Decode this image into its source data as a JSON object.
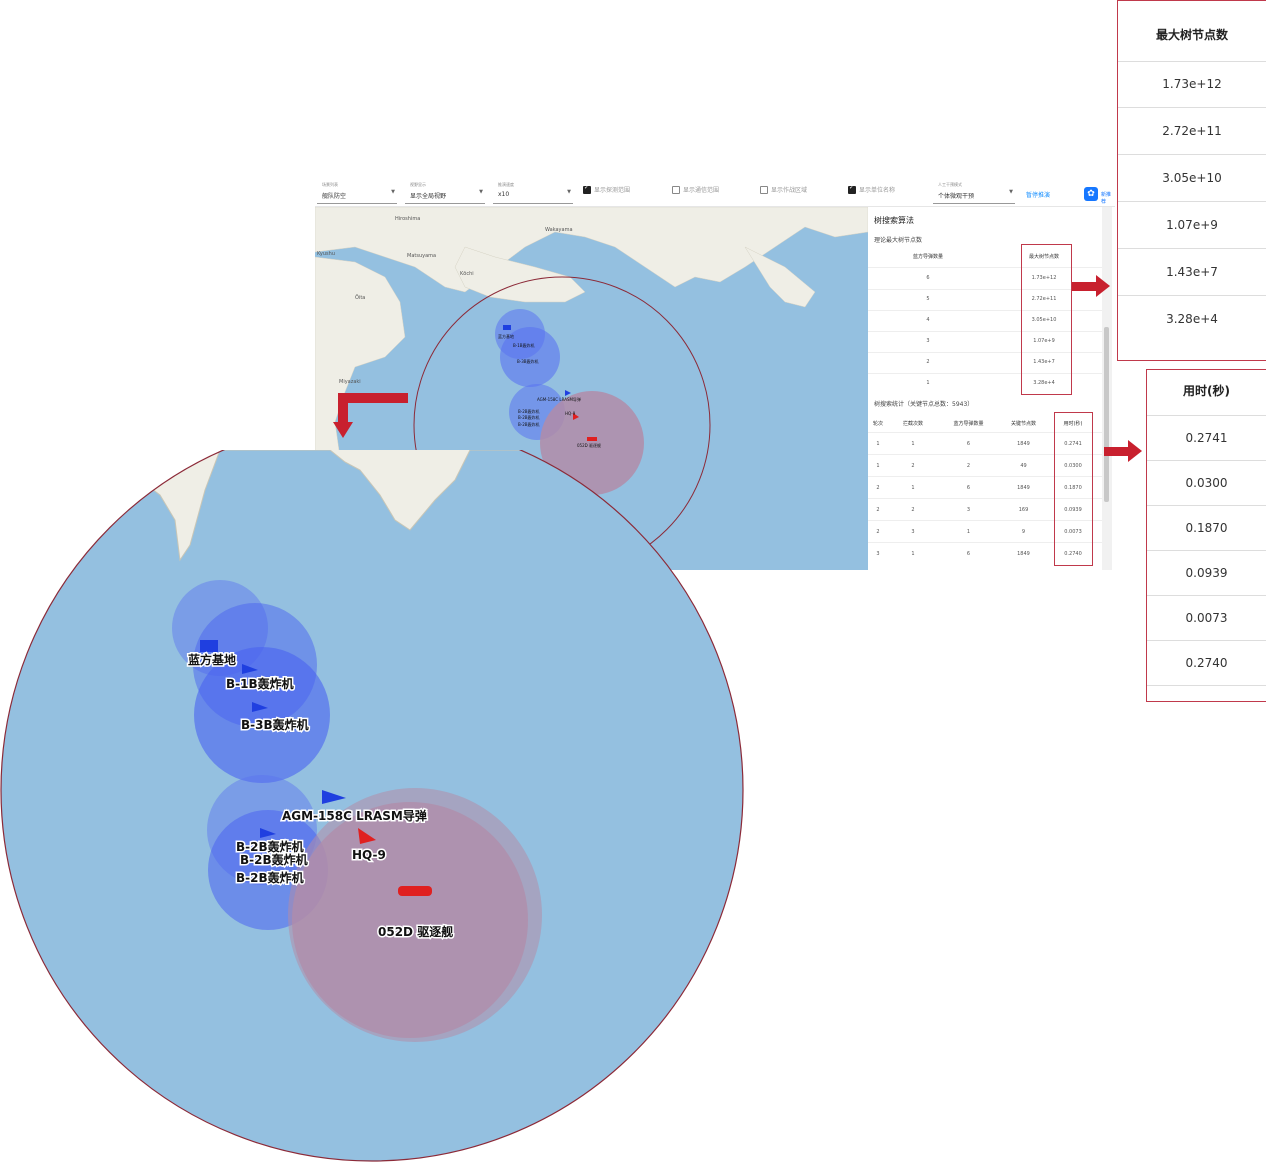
{
  "toolbar": {
    "select1": {
      "label": "场景列表",
      "value": "舰队防空"
    },
    "select2": {
      "label": "视野显示",
      "value": "显示全局视野"
    },
    "select3": {
      "label": "推演速度",
      "value": "x10"
    },
    "checks": [
      {
        "label": "显示探测范围",
        "checked": true
      },
      {
        "label": "显示通信范围",
        "checked": false
      },
      {
        "label": "显示作战区域",
        "checked": false
      },
      {
        "label": "显示单位名称",
        "checked": true
      }
    ],
    "select4": {
      "label": "人工干预模式",
      "value": "个体微观干预"
    },
    "stop_link": "暂停推演",
    "ai_label": "新推荐"
  },
  "map": {
    "places": [
      "Hiroshima",
      "Matsuyama",
      "Kōchi",
      "Wakayama",
      "Ōita",
      "Miyazaki",
      "Kyushu"
    ],
    "small_labels": [
      "蓝方基地",
      "B-1B轰炸机",
      "B-3B轰炸机",
      "B-2B轰炸机",
      "B-2B轰炸机",
      "B-2B轰炸机",
      "AGM-158C LRASM导弹",
      "HQ-9",
      "052D 驱逐舰"
    ]
  },
  "zoom": {
    "labels": {
      "base": "蓝方基地",
      "b1b": "B-1B轰炸机",
      "b3b": "B-3B轰炸机",
      "b2b_1": "B-2B轰炸机",
      "b2b_2": "B-2B轰炸机",
      "b2b_3": "B-2B轰炸机",
      "agm": "AGM-158C LRASM导弹",
      "hq9": "HQ-9",
      "ship": "052D 驱逐舰"
    }
  },
  "panel": {
    "title": "树搜索算法",
    "theory_title": "理论最大树节点数",
    "theory_headers": [
      "蓝方导弹数量",
      "最大树节点数"
    ],
    "theory_rows": [
      [
        "6",
        "1.73e+12"
      ],
      [
        "5",
        "2.72e+11"
      ],
      [
        "4",
        "3.05e+10"
      ],
      [
        "3",
        "1.07e+9"
      ],
      [
        "2",
        "1.43e+7"
      ],
      [
        "1",
        "3.28e+4"
      ]
    ],
    "stats_title": "树搜索统计（关键节点总数：5943）",
    "stats_headers": [
      "轮次",
      "拦截次数",
      "蓝方导弹数量",
      "关键节点数",
      "用时(秒)"
    ],
    "stats_rows": [
      [
        "1",
        "1",
        "6",
        "1849",
        "0.2741"
      ],
      [
        "1",
        "2",
        "2",
        "49",
        "0.0300"
      ],
      [
        "2",
        "1",
        "6",
        "1849",
        "0.1870"
      ],
      [
        "2",
        "2",
        "3",
        "169",
        "0.0939"
      ],
      [
        "2",
        "3",
        "1",
        "9",
        "0.0073"
      ],
      [
        "3",
        "1",
        "6",
        "1849",
        "0.2740"
      ]
    ]
  },
  "big_nodes": {
    "header": "最大树节点数",
    "values": [
      "1.73e+12",
      "2.72e+11",
      "3.05e+10",
      "1.07e+9",
      "1.43e+7",
      "3.28e+4"
    ]
  },
  "big_time": {
    "header": "用时(秒)",
    "values": [
      "0.2741",
      "0.0300",
      "0.1870",
      "0.0939",
      "0.0073",
      "0.2740"
    ]
  },
  "colors": {
    "sea": "#94c0e0",
    "land": "#efeee6",
    "accent_red": "#c8202e",
    "blue_unit": "#4b64f0",
    "red_zone": "#b28ca8"
  }
}
